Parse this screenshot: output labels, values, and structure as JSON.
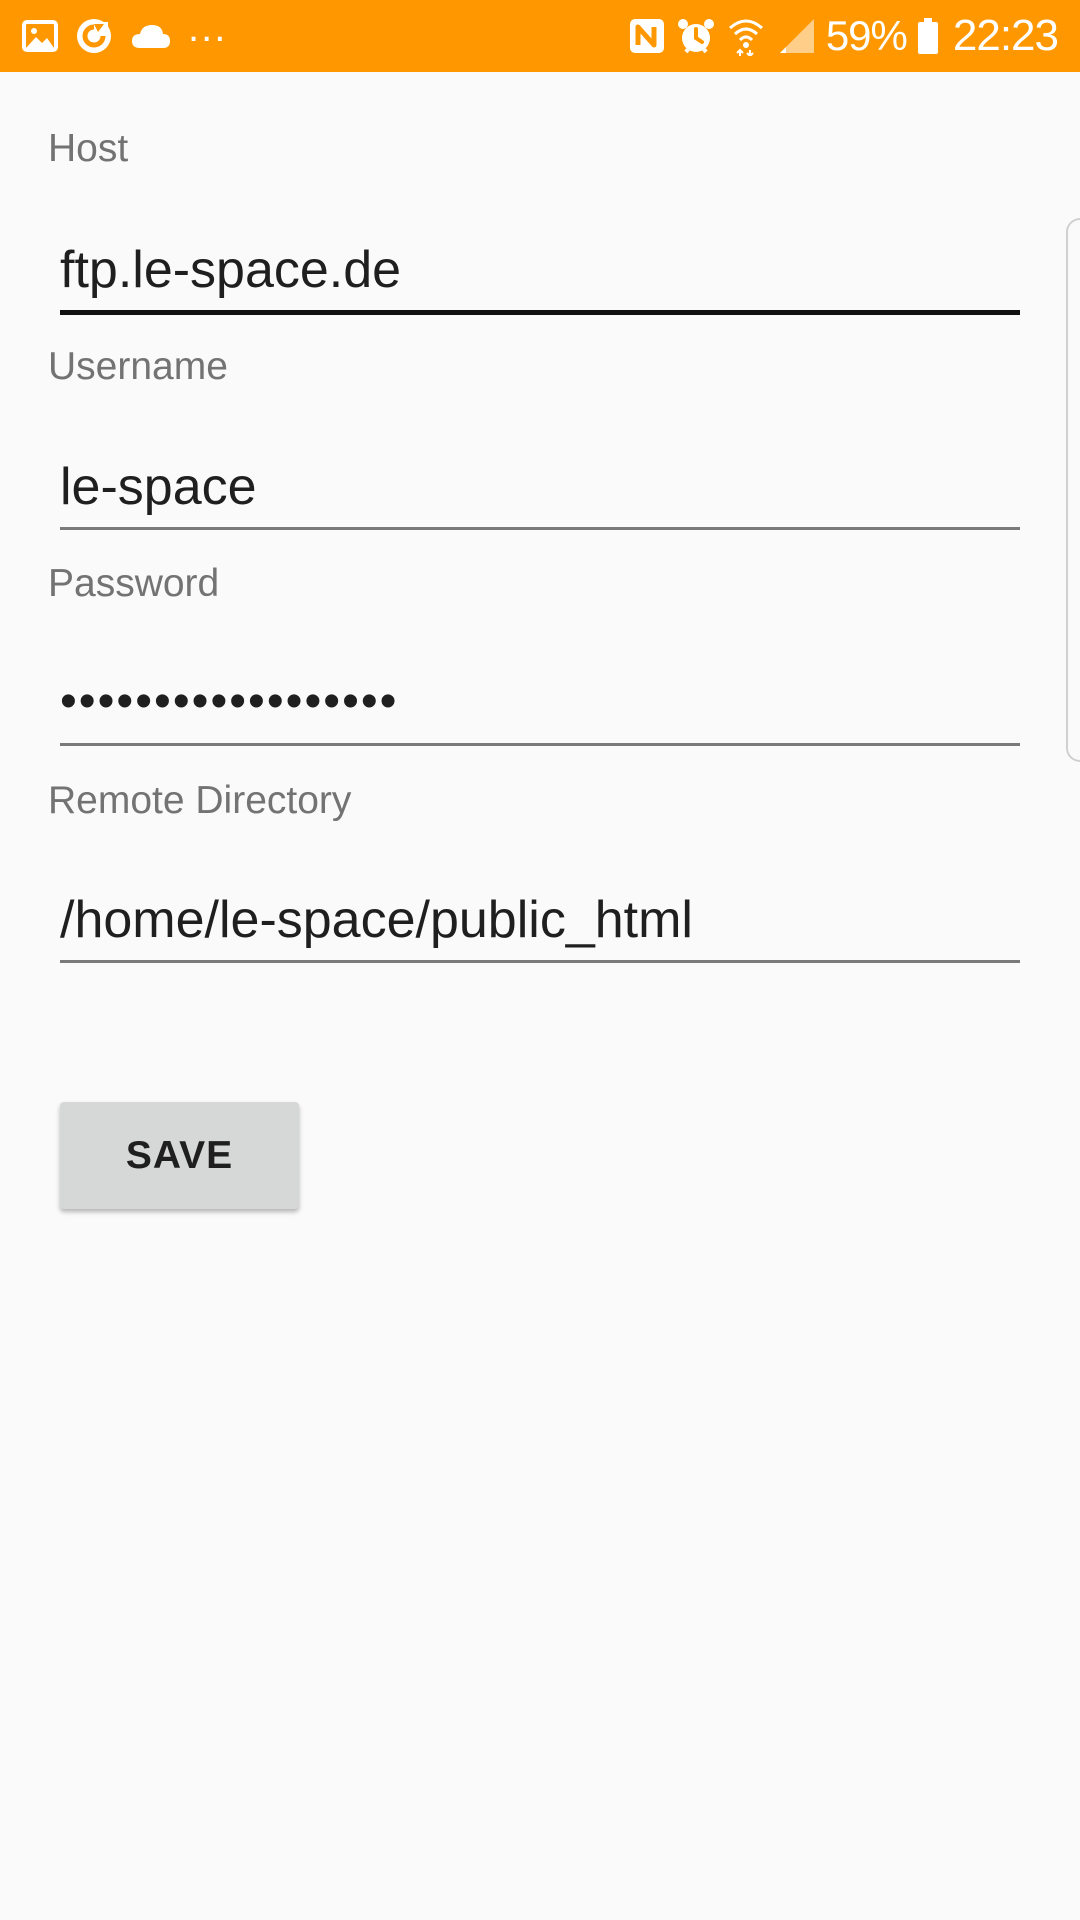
{
  "status_bar": {
    "left_icons": [
      "gallery-icon",
      "sync-icon",
      "cloud-icon"
    ],
    "more_indicator": "...",
    "right_icons": [
      "nfc-icon",
      "alarm-icon",
      "wifi-icon",
      "signal-icon",
      "battery-icon"
    ],
    "battery_percent": "59%",
    "time": "22:23",
    "background_color": "#ff9800"
  },
  "form": {
    "host": {
      "label": "Host",
      "value": "ftp.le-space.de",
      "focused": true
    },
    "username": {
      "label": "Username",
      "value": "le-space"
    },
    "password": {
      "label": "Password",
      "value": "••••••••••••••••••"
    },
    "remote_directory": {
      "label": "Remote Directory",
      "value": "/home/le-space/public_html"
    },
    "save_label": "SAVE"
  }
}
